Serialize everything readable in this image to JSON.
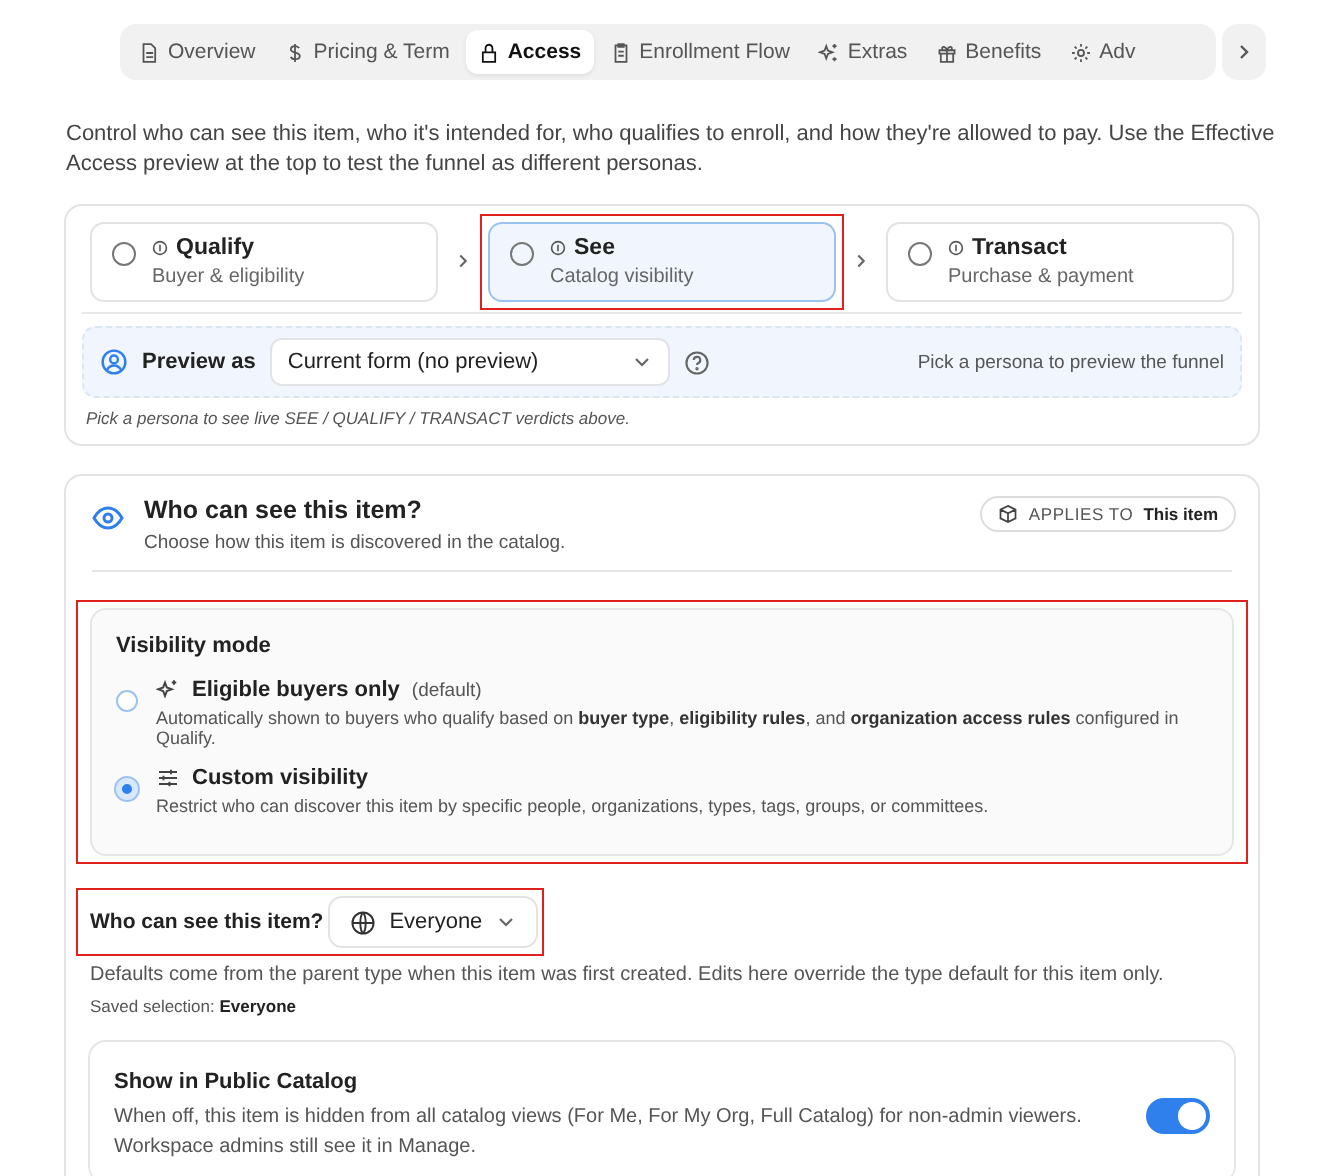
{
  "tabs": [
    {
      "label": "Overview",
      "selected": false
    },
    {
      "label": "Pricing & Term",
      "selected": false
    },
    {
      "label": "Access",
      "selected": true
    },
    {
      "label": "Enrollment Flow",
      "selected": false
    },
    {
      "label": "Extras",
      "selected": false
    },
    {
      "label": "Benefits",
      "selected": false
    },
    {
      "label": "Adv",
      "selected": false
    }
  ],
  "intro": "Control who can see this item, who it's intended for, who qualifies to enroll, and how they're allowed to pay. Use the Effective Access preview at the top to test the funnel as different personas.",
  "funnel": {
    "steps": [
      {
        "title": "Qualify",
        "subtitle": "Buyer & eligibility",
        "selected": false,
        "highlighted": false
      },
      {
        "title": "See",
        "subtitle": "Catalog visibility",
        "selected": true,
        "highlighted": true
      },
      {
        "title": "Transact",
        "subtitle": "Purchase & payment",
        "selected": false,
        "highlighted": false
      }
    ],
    "preview": {
      "label": "Preview as",
      "value": "Current form (no preview)",
      "hint": "Pick a persona to preview the funnel"
    },
    "note": "Pick a persona to see live SEE / QUALIFY / TRANSACT verdicts above."
  },
  "section": {
    "title": "Who can see this item?",
    "subtitle": "Choose how this item is discovered in the catalog.",
    "applies_label": "APPLIES TO",
    "applies_value": "This item",
    "visibility": {
      "title": "Visibility mode",
      "highlighted": true,
      "options": [
        {
          "label": "Eligible buyers only",
          "tag": "(default)",
          "description": "Automatically shown to buyers who qualify based on **buyer type**, **eligibility rules**, and **organization access rules** configured in Qualify.",
          "selected": false
        },
        {
          "label": "Custom visibility",
          "description": "Restrict who can discover this item by specific people, organizations, types, tags, groups, or committees.",
          "selected": true
        }
      ]
    },
    "audience": {
      "label": "Who can see this item?",
      "value": "Everyone",
      "highlighted": true
    },
    "defaults_note": "Defaults come from the parent type when this item was first created. Edits here override the type default for this item only.",
    "saved": "Saved selection: **Everyone**",
    "public_catalog": {
      "title": "Show in Public Catalog",
      "description": "When off, this item is hidden from all catalog views (For Me, For My Org, Full Catalog) for non-admin viewers. Workspace admins still see it in Manage.",
      "on": true
    }
  }
}
